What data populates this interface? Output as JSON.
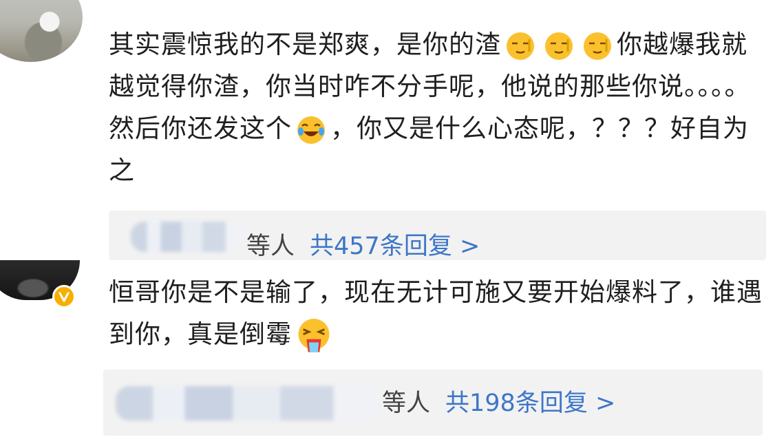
{
  "comments": [
    {
      "text_parts": [
        "其实震惊我的不是郑爽，是你的渣",
        "你越爆我就越觉得你渣，你当时咋不分手呢，他说的那些你说。。。。然后你还发这个",
        "，你又是什么心态呢，？？？好自为之"
      ],
      "emojis": [
        "squint-emoji-icon",
        "squint-emoji-icon",
        "squint-emoji-icon",
        "laugh-cry-emoji-icon"
      ],
      "replies": {
        "others_label": "等人",
        "count_label": "共457条回复 >"
      }
    },
    {
      "text_parts": [
        "恒哥你是不是输了，现在无计可施又要开始爆料了，谁遇到你，真是倒霉"
      ],
      "emojis": [
        "vomit-emoji-icon"
      ],
      "verified": true,
      "replies": {
        "others_label": "等人",
        "count_label": "共198条回复 >"
      }
    }
  ],
  "colors": {
    "link": "#3d76c8",
    "reply_bg": "#f2f2f2",
    "badge": "#f5b100"
  }
}
